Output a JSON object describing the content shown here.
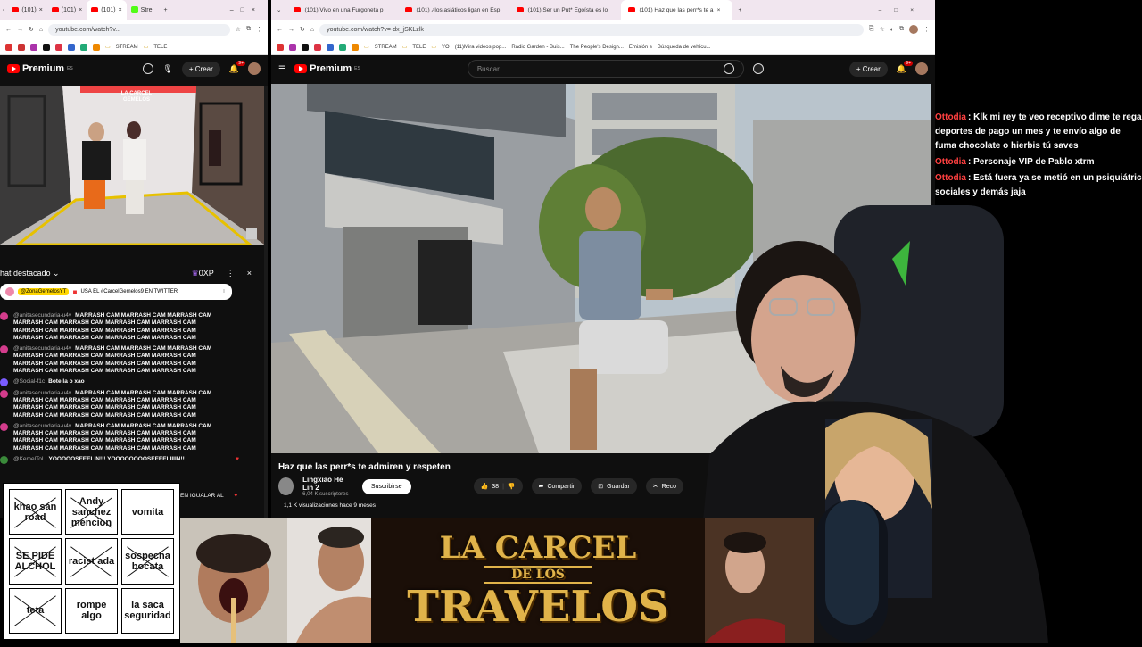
{
  "left_browser": {
    "tabs": [
      "(101)",
      "(101)",
      "(101)",
      "Stre"
    ],
    "url": "youtube.com/watch?v...",
    "bookmarks": [
      "STREAM",
      "TELE"
    ],
    "yt_logo": "Premium",
    "yt_region": "ES",
    "create_label": "Crear",
    "notif_count": "9+",
    "video_overlay_text": "LA CARCEL GEMELOS",
    "chat": {
      "header": "hat destacado",
      "points": "0XP",
      "pinned_user": "@ZonaGemelosYT",
      "pinned_text": "USA EL #CarcelGemelos9 EN TWITTER",
      "messages": [
        {
          "author": "@anitasecundaria-u4v",
          "text": "MARRASH CAM MARRASH CAM MARRASH CAM MARRASH CAM MARRASH CAM MARRASH CAM MARRASH CAM MARRASH CAM MARRASH CAM MARRASH CAM MARRASH CAM MARRASH CAM MARRASH CAM MARRASH CAM MARRASH CAM"
        },
        {
          "author": "@anitasecundaria-u4v",
          "text": "MARRASH CAM MARRASH CAM MARRASH CAM MARRASH CAM MARRASH CAM MARRASH CAM MARRASH CAM MARRASH CAM MARRASH CAM MARRASH CAM MARRASH CAM MARRASH CAM MARRASH CAM MARRASH CAM MARRASH CAM"
        },
        {
          "author": "@Social-f1c",
          "text": "Botella o xao"
        },
        {
          "author": "@anitasecundaria-u4v",
          "text": "MARRASH CAM MARRASH CAM MARRASH CAM MARRASH CAM MARRASH CAM MARRASH CAM MARRASH CAM MARRASH CAM MARRASH CAM MARRASH CAM MARRASH CAM MARRASH CAM MARRASH CAM MARRASH CAM MARRASH CAM"
        },
        {
          "author": "@anitasecundaria-u4v",
          "text": "MARRASH CAM MARRASH CAM MARRASH CAM MARRASH CAM MARRASH CAM MARRASH CAM MARRASH CAM MARRASH CAM MARRASH CAM MARRASH CAM MARRASH CAM MARRASH CAM MARRASH CAM MARRASH CAM MARRASH CAM"
        },
        {
          "author": "@KemelToL",
          "text": "YOOOOOSEEELIN!!! YOOOOOOOOSEEEELIIIIN!!"
        }
      ],
      "input_tail": "EN IGUALAR AL"
    }
  },
  "right_browser": {
    "tabs": [
      "(101) Vivo en una Furgoneta p",
      "(101) ¿los asiáticos ligan en Esp",
      "(101) Ser un Put* Egoísta es lo",
      "(101) Haz que las perr*s te a"
    ],
    "url": "youtube.com/watch?v=-dx_jSKLzlk",
    "bookmarks": [
      "STREAM",
      "TELE",
      "YO",
      "(11)Mira videos pop...",
      "Radio Garden - Buis...",
      "The People's Design...",
      "Emisión s",
      "Búsqueda de vehícu..."
    ],
    "yt_logo": "Premium",
    "yt_region": "ES",
    "search_placeholder": "Buscar",
    "create_label": "Crear",
    "notif_count": "9+",
    "video_title": "Haz que las perr*s te admiren y respeten",
    "channel": "Lingxiao He Lin 2",
    "subs": "6,04 K suscriptores",
    "subscribe": "Suscribirse",
    "likes": "38",
    "share": "Compartir",
    "save": "Guardar",
    "clip": "Reco",
    "views": "1,1 K visualizaciones  hace 9 meses"
  },
  "stream_chat": [
    {
      "user": "Ottodia",
      "text": ": Klk mi rey te veo receptivo dime te rega deportes de pago un mes y te envío algo de fuma chocolate o hierbis tú saves"
    },
    {
      "user": "Ottodia",
      "text": ": Personaje VIP de Pablo xtrm"
    },
    {
      "user": "Ottodia",
      "text": ": Está fuera ya se metió en un psiquiátric sociales y demás jaja"
    }
  ],
  "bingo": [
    {
      "text": "khao san road",
      "crossed": true
    },
    {
      "text": "Andy sanchez mencion",
      "crossed": true
    },
    {
      "text": "vomita",
      "crossed": false
    },
    {
      "text": "SE PIDE ALCHOL",
      "crossed": true
    },
    {
      "text": "racist ada",
      "crossed": true
    },
    {
      "text": "sospecha bocata",
      "crossed": true
    },
    {
      "text": "teta",
      "crossed": true
    },
    {
      "text": "rompe algo",
      "crossed": false
    },
    {
      "text": "la saca seguridad",
      "crossed": false
    }
  ],
  "banner": {
    "line1": "LA CARCEL",
    "line2": "DE LOS",
    "line3": "TRAVELOS"
  }
}
